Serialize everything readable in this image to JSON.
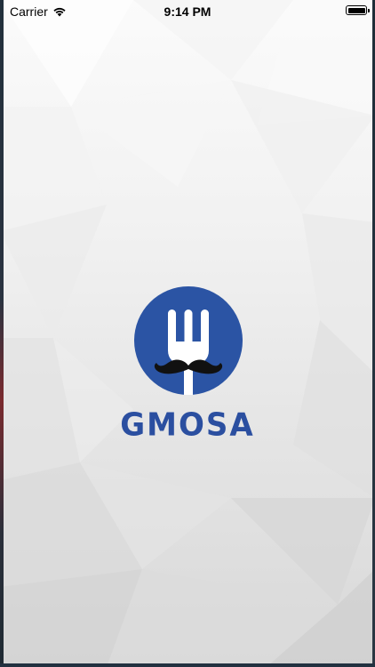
{
  "status_bar": {
    "carrier": "Carrier",
    "time": "9:14 PM",
    "battery_level": 1.0
  },
  "splash": {
    "brand_name": "GMOSA",
    "logo_icon": "fork-mustache-logo",
    "brand_color": "#2b4fa0"
  }
}
